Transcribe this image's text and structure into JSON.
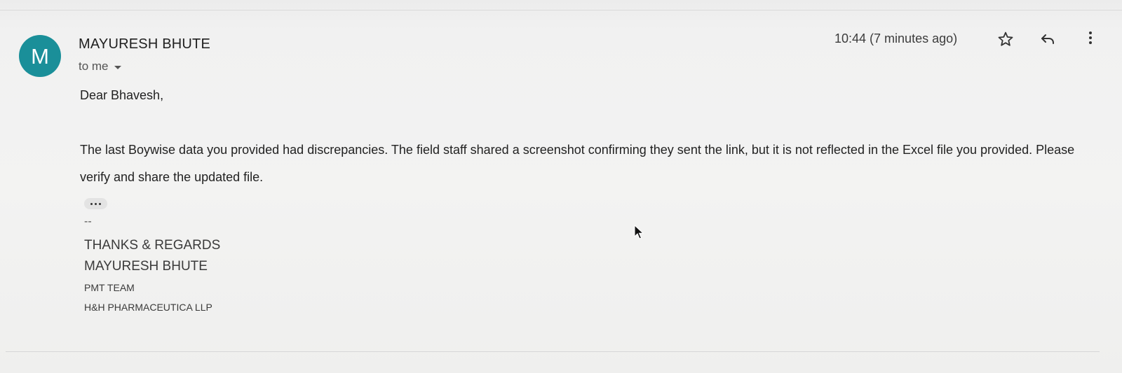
{
  "sender": {
    "avatar_letter": "M",
    "name": "MAYURESH BHUTE",
    "avatar_color": "#1a8f99"
  },
  "recipient": {
    "label": "to me"
  },
  "timestamp": "10:44 (7 minutes ago)",
  "actions": {
    "star_icon": "star-outline-icon",
    "reply_icon": "reply-arrow-icon",
    "more_icon": "vertical-dots-icon"
  },
  "message": {
    "greeting": "Dear Bhavesh,",
    "paragraph": "The last Boywise data you provided had discrepancies. The field staff shared a screenshot confirming they sent the link, but it is not reflected in the Excel file you provided. Please verify and share the updated file."
  },
  "signature": {
    "dash": "--",
    "thanks": "THANKS & REGARDS",
    "name": "MAYURESH BHUTE",
    "team": "PMT TEAM",
    "company": "H&H PHARMACEUTICA LLP"
  }
}
